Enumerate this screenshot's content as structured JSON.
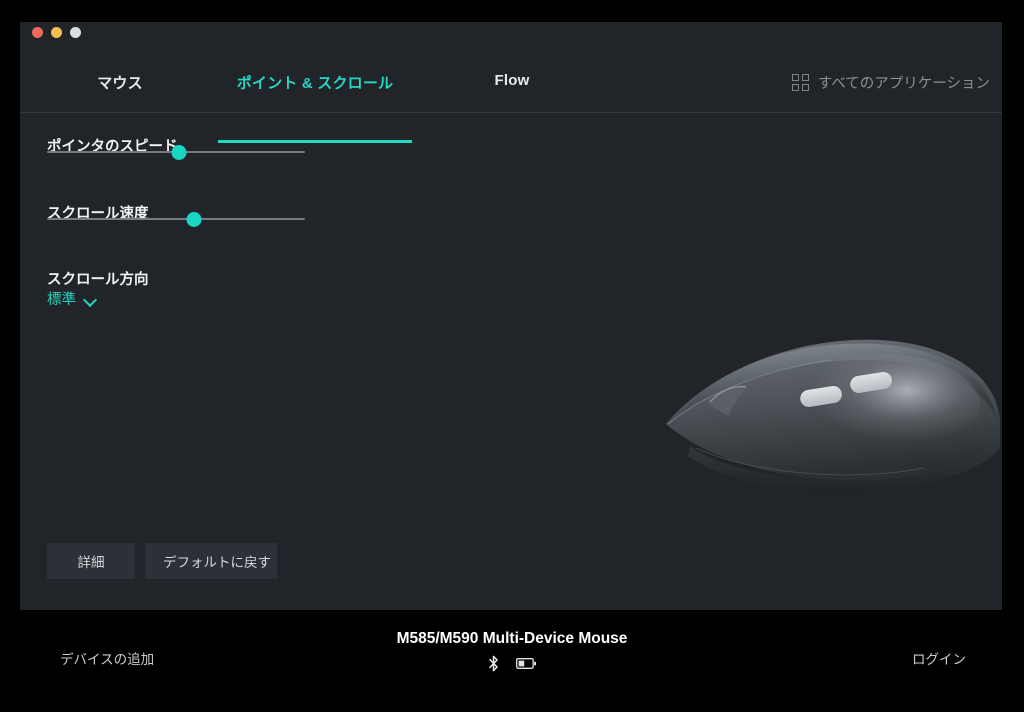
{
  "window": {
    "traffic_lights": [
      {
        "name": "close",
        "color": "#ed6a5e"
      },
      {
        "name": "minimize",
        "color": "#f5bf4f"
      },
      {
        "name": "maximize",
        "color": "#dddddd"
      }
    ]
  },
  "tabs": [
    {
      "label": "マウス",
      "active": false
    },
    {
      "label": "ポイント & スクロール",
      "active": true
    },
    {
      "label": "Flow",
      "active": false
    }
  ],
  "all_apps": {
    "label": "すべてのアプリケーション",
    "icon": "grid-icon"
  },
  "settings": {
    "pointer_speed": {
      "label": "ポインタのスピード",
      "value_percent": 51
    },
    "scroll_speed": {
      "label": "スクロール速度",
      "value_percent": 57
    },
    "scroll_direction": {
      "label": "スクロール方向",
      "value": "標準",
      "chevron": "chevron-down-icon"
    }
  },
  "buttons": {
    "details": "詳細",
    "restore_defaults": "デフォルトに戻す"
  },
  "footer": {
    "add_device": "デバイスの追加",
    "device_name": "M585/M590 Multi-Device Mouse",
    "login": "ログイン",
    "status_icons": [
      "bluetooth-icon",
      "battery-icon"
    ]
  },
  "colors": {
    "accent": "#26d7c4",
    "window_bg": "#212529",
    "footer_bg": "#000000",
    "text_primary": "#f0f2f4",
    "text_muted": "#8b9094"
  }
}
